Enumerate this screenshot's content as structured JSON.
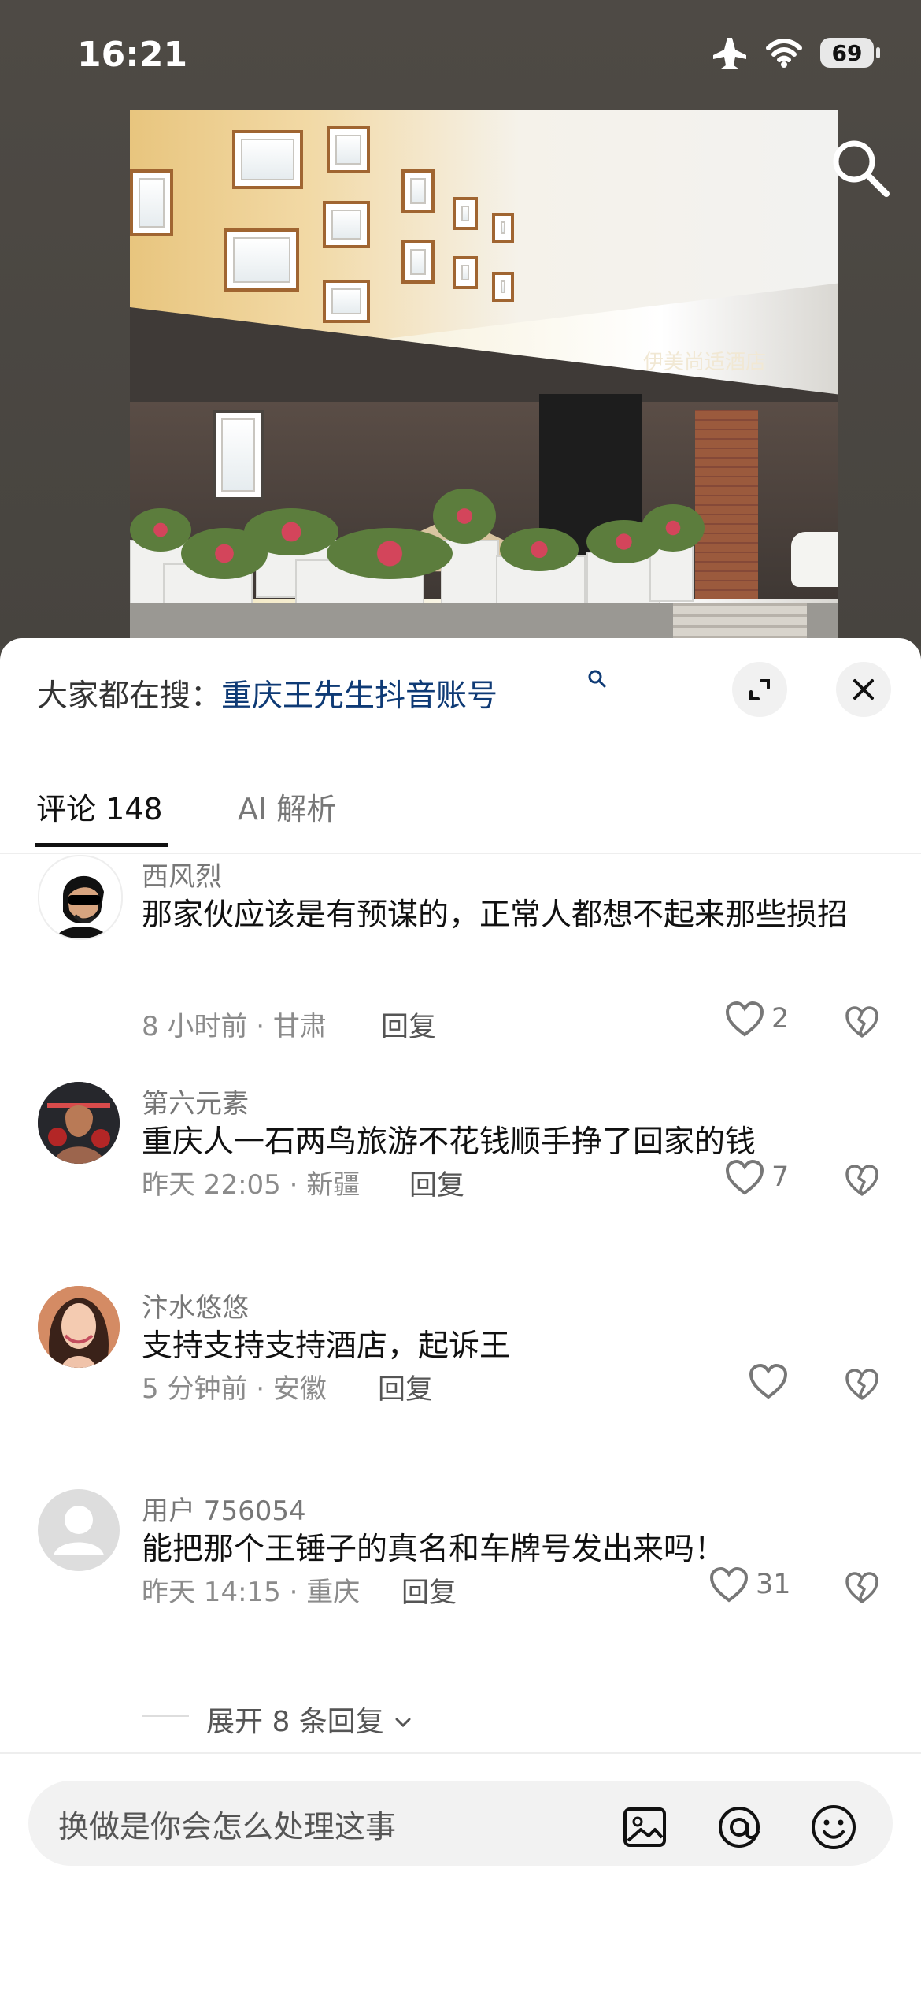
{
  "status_bar": {
    "time": "16:21",
    "battery": "69",
    "icons": [
      "airplane-icon",
      "wifi-icon",
      "battery-icon"
    ]
  },
  "photo": {
    "sign_text": "伊美尚适酒店",
    "search_icon": "search-icon"
  },
  "sheet": {
    "search_prefix": "大家都在搜：",
    "search_query": "重庆王先生抖音账号",
    "expand_icon": "expand-icon",
    "close_icon": "close-icon"
  },
  "tabs": [
    {
      "label": "评论 148",
      "active": true
    },
    {
      "label": "AI 解析",
      "active": false
    }
  ],
  "comments": [
    {
      "name": "西风烈",
      "text": "那家伙应该是有预谋的，正常人都想不起来那些损招",
      "meta": "8 小时前 · 甘肃",
      "reply": "回复",
      "likes": "2",
      "avatar": "man-sunglasses-avatar"
    },
    {
      "name": "第六元素",
      "text": "重庆人一石两鸟旅游不花钱顺手挣了回家的钱",
      "meta": "昨天 22:05 · 新疆",
      "reply": "回复",
      "likes": "7",
      "avatar": "fighter-avatar"
    },
    {
      "name": "汴水悠悠",
      "text": "支持支持支持酒店，起诉王",
      "meta": "5 分钟前 · 安徽",
      "reply": "回复",
      "likes": "",
      "avatar": "woman-avatar"
    },
    {
      "name": "用户 756054",
      "text": "能把那个王锤子的真名和车牌号发出来吗！",
      "meta": "昨天 14:15 · 重庆",
      "reply": "回复",
      "likes": "31",
      "avatar": "default-user-avatar"
    }
  ],
  "expand_replies": "展开 8 条回复",
  "bottom_bar": {
    "placeholder": "换做是你会怎么处理这事",
    "icons": [
      "image-icon",
      "at-icon",
      "emoji-icon"
    ]
  },
  "colors": {
    "search_link": "#0e3a75",
    "text_primary": "#111111",
    "text_secondary": "#777777"
  }
}
